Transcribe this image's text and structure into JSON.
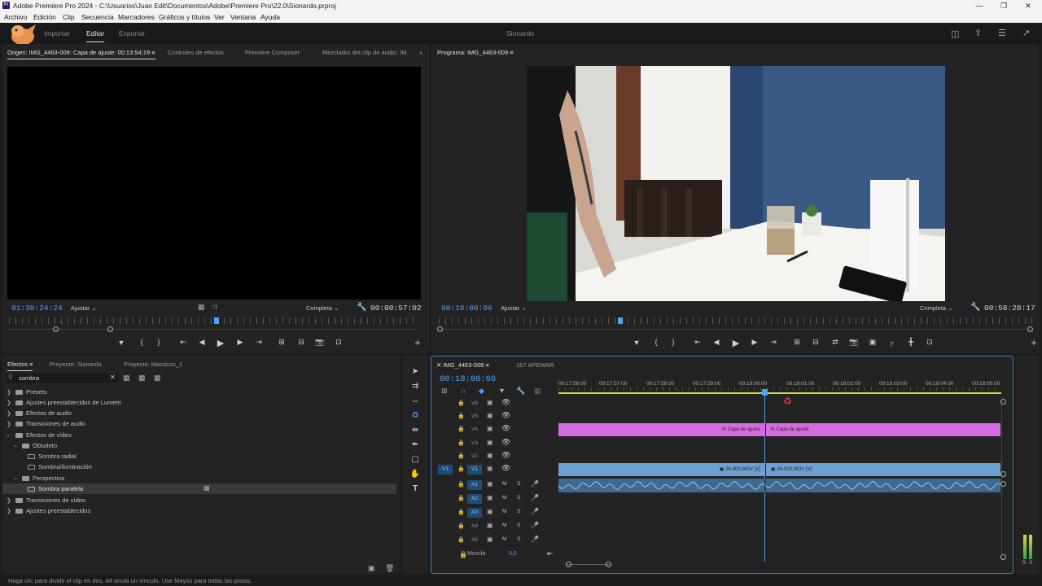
{
  "window": {
    "title": "Adobe Premiere Pro 2024 - C:\\Usuarios\\Juan Edit\\Documentos\\Adobe\\Premiere Pro\\22.0\\Sionardo.prproj",
    "app_icon_text": "Pr"
  },
  "menu": [
    "Archivo",
    "Edición",
    "Clip",
    "Secuencia",
    "Marcadores",
    "Gráficos y títulos",
    "Ver",
    "Ventana",
    "Ayuda"
  ],
  "workspace": {
    "tabs": [
      "Importar",
      "Editar",
      "Exportar"
    ],
    "active_tab": "Editar",
    "project_name": "Sionardo"
  },
  "source_panel": {
    "tabs": [
      "Origen: IMG_4463-009: Capa de ajuste: 00:13:54:19",
      "Controles de efectos",
      "Premiere Composer",
      "Mezclador del clip de audio: IM("
    ],
    "timecode": "01:30:24:24",
    "fit": "Ajustar",
    "quality": "Completa",
    "duration": "00:00:57:02"
  },
  "program_panel": {
    "tab": "Programa: IMG_4463-009",
    "timecode": "00:18:00:06",
    "fit": "Ajustar",
    "quality": "Completa",
    "duration": "00:58:28:17"
  },
  "effects_panel": {
    "tabs": [
      "Efectos",
      "Proyecto: Sionardo",
      "Proyecto: Macacos_1"
    ],
    "search_value": "sombra",
    "tree": [
      {
        "label": "Presets",
        "level": 0,
        "expanded": false
      },
      {
        "label": "Ajustes preestablecidos de Lumetri",
        "level": 0,
        "expanded": false
      },
      {
        "label": "Efectos de audio",
        "level": 0,
        "expanded": false
      },
      {
        "label": "Transiciones de audio",
        "level": 0,
        "expanded": false
      },
      {
        "label": "Efectos de vídeo",
        "level": 0,
        "expanded": true
      },
      {
        "label": "Obsoleto",
        "level": 1,
        "expanded": true
      },
      {
        "label": "Sombra radial",
        "level": 2,
        "expanded": null
      },
      {
        "label": "Sombra/iluminación",
        "level": 2,
        "expanded": null
      },
      {
        "label": "Perspectiva",
        "level": 1,
        "expanded": true
      },
      {
        "label": "Sombra paralela",
        "level": 2,
        "expanded": null,
        "selected": true
      },
      {
        "label": "Transiciones de vídeo",
        "level": 0,
        "expanded": false
      },
      {
        "label": "Ajustes preestablecidos",
        "level": 0,
        "expanded": false
      }
    ]
  },
  "timeline": {
    "tabs": [
      "IMG_4463-009",
      "167 APEWAR"
    ],
    "timecode": "00:18:00:06",
    "ruler": [
      "00:17:56:00",
      "00:17:57:00",
      "00:17:58:00",
      "00:17:59:00",
      "00:18:00:00",
      "00:18:01:00",
      "00:18:02:00",
      "00:18:03:00",
      "00:18:04:00",
      "00:18:05:00"
    ],
    "video_tracks": [
      "V6",
      "V5",
      "V4",
      "V3",
      "V2",
      "V1"
    ],
    "audio_tracks": [
      "A1",
      "A2",
      "A3",
      "A4",
      "A5"
    ],
    "source_patch_v": "V1",
    "mix_label": "Mezcla",
    "mix_value": "0,0",
    "track_btn_m": "M",
    "track_btn_s": "S",
    "clips": {
      "adjustment_a": "Capa de ajuste",
      "adjustment_b": "Capa de ajuste",
      "video_a": "24-003.MOV [V]",
      "video_b": "24-003.MOV [V]"
    },
    "colors": {
      "adjustment": "#d46be0",
      "video": "#6e9fd3",
      "audio": "#3f6a8e",
      "playhead": "#4aa3ff"
    }
  },
  "meter": {
    "labels": [
      "S",
      "S"
    ]
  },
  "status_bar": "Haga clic para dividir el clip en dos. Alt anula un vínculo. Use Mayús para todas las pistas."
}
